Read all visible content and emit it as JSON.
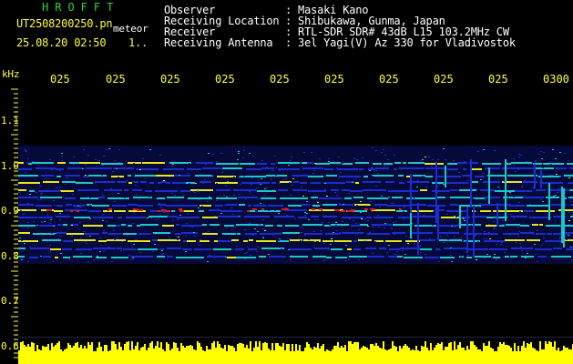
{
  "header": {
    "title": "HROFFT",
    "filename": "UT2508200250.pn",
    "meteor_tag": "meteor",
    "datetime": "25.08.20 02:50",
    "datetime_extra": "1..",
    "fields": [
      {
        "label": "Observer",
        "value": ": Masaki Kano"
      },
      {
        "label": "Receiving Location",
        "value": ": Shibukawa, Gunma, Japan"
      },
      {
        "label": "Receiver",
        "value": ": RTL-SDR SDR# 43dB L15 103.2MHz CW"
      },
      {
        "label": "Receiving Antenna",
        "value": ": 3el Yagi(V) Az 330 for Vladivostok"
      }
    ]
  },
  "axis": {
    "freq_unit": "kHz",
    "time_labels": [
      "025",
      "025",
      "025",
      "025",
      "025",
      "025",
      "025",
      "025",
      "025",
      "0300"
    ],
    "freq_labels": [
      "1.1",
      "1.0",
      "0.9",
      "0.8",
      "0.7",
      "0.6"
    ]
  },
  "colors": {
    "background": "#000000",
    "text_yellow": "#ffff33",
    "title_green": "#2fd82f",
    "noise_floor": "#ffff00",
    "signal_low": "#1a2cd0",
    "signal_mid": "#19c8c8",
    "signal_high": "#e8e818",
    "signal_peak": "#e81818"
  }
}
